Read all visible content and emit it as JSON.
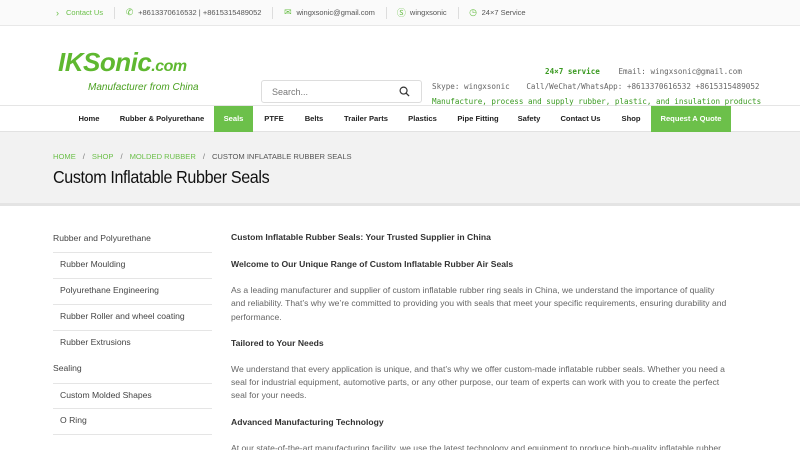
{
  "topbar": {
    "contact": "Contact Us",
    "phone": "+8613370616532 | +8615315489052",
    "email": "wingxsonic@gmail.com",
    "skype": "wingxsonic",
    "service": "24×7 Service"
  },
  "header": {
    "logo_main": "IKSonic",
    "logo_domain": ".com",
    "logo_tagline": "Manufacturer from China",
    "search_placeholder": "Search...",
    "service": "24×7 service",
    "email": "Email: wingxsonic@gmail.com",
    "skype": "Skype: wingxsonic",
    "call": "Call/WeChat/WhatsApp: +8613370616532 +8615315489052",
    "tagline": "Manufacture, process and supply rubber, plastic, and insulation products"
  },
  "nav": [
    {
      "label": "Home"
    },
    {
      "label": "Rubber & Polyurethane"
    },
    {
      "label": "Seals"
    },
    {
      "label": "PTFE"
    },
    {
      "label": "Belts"
    },
    {
      "label": "Trailer Parts"
    },
    {
      "label": "Plastics"
    },
    {
      "label": "Pipe Fitting"
    },
    {
      "label": "Safety"
    },
    {
      "label": "Contact Us"
    },
    {
      "label": "Shop"
    },
    {
      "label": "Request A Quote"
    }
  ],
  "breadcrumb": {
    "home": "HOME",
    "shop": "SHOP",
    "molded": "MOLDED RUBBER",
    "current": "CUSTOM INFLATABLE RUBBER SEALS",
    "sep": "/"
  },
  "page_title": "Custom Inflatable Rubber Seals",
  "sidebar": [
    {
      "label": "Rubber and Polyurethane"
    },
    {
      "label": "Rubber Moulding"
    },
    {
      "label": "Polyurethane Engineering"
    },
    {
      "label": "Rubber Roller and wheel coating"
    },
    {
      "label": "Rubber Extrusions"
    },
    {
      "label": "Sealing"
    },
    {
      "label": "Custom Molded Shapes"
    },
    {
      "label": "O Ring"
    }
  ],
  "content": {
    "h1": "Custom Inflatable Rubber Seals: Your Trusted Supplier in China",
    "h2": "Welcome to Our Unique Range of Custom Inflatable Rubber Air Seals",
    "p1_l1": "As a leading manufacturer and supplier of custom inflatable rubber ring seals in China, we understand the importance of quality",
    "p1_l2": "and reliability. That’s why we’re committed to providing you with seals that meet your specific requirements, ensuring durability and",
    "p1_l3": "performance.",
    "h3": "Tailored to Your Needs",
    "p2_l1": "We understand that every application is unique, and that’s why we offer custom-made inflatable rubber seals. Whether you need a",
    "p2_l2": "seal for industrial equipment, automotive parts, or any other purpose, our team of experts can work with you to create the perfect",
    "p2_l3": "seal for your needs.",
    "h4": "Advanced Manufacturing Technology",
    "p3_l1": "At our state-of-the-art manufacturing facility, we use the latest technology and equipment to produce high-quality inflatable rubber"
  },
  "colors": {
    "accent": "#6cc04a",
    "text_green": "#3b9a22"
  }
}
